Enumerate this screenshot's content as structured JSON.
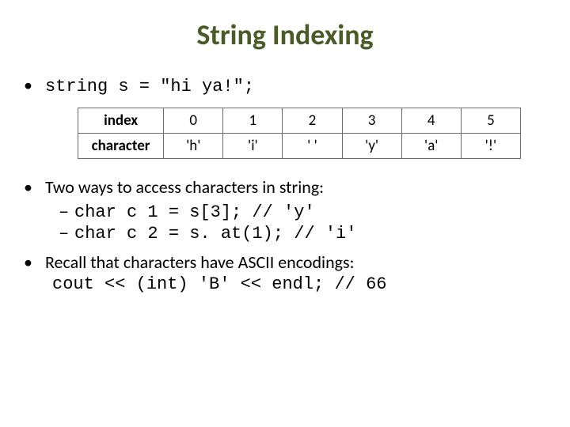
{
  "title": "String Indexing",
  "bullet1": "string s = \"hi ya!\";",
  "table": {
    "row1_label": "index",
    "row2_label": "character",
    "cols": [
      "0",
      "1",
      "2",
      "3",
      "4",
      "5"
    ],
    "chars": [
      "'h'",
      "'i'",
      "' '",
      "'y'",
      "'a'",
      "'!'"
    ]
  },
  "bullet2": "Two ways to access characters in string:",
  "sub1": "char c 1 = s[3];    // 'y'",
  "sub2": "char c 2 = s. at(1); // 'i'",
  "bullet3": "Recall that characters have ASCII encodings:",
  "code_line": "cout << (int) 'B' << endl;  // 66"
}
